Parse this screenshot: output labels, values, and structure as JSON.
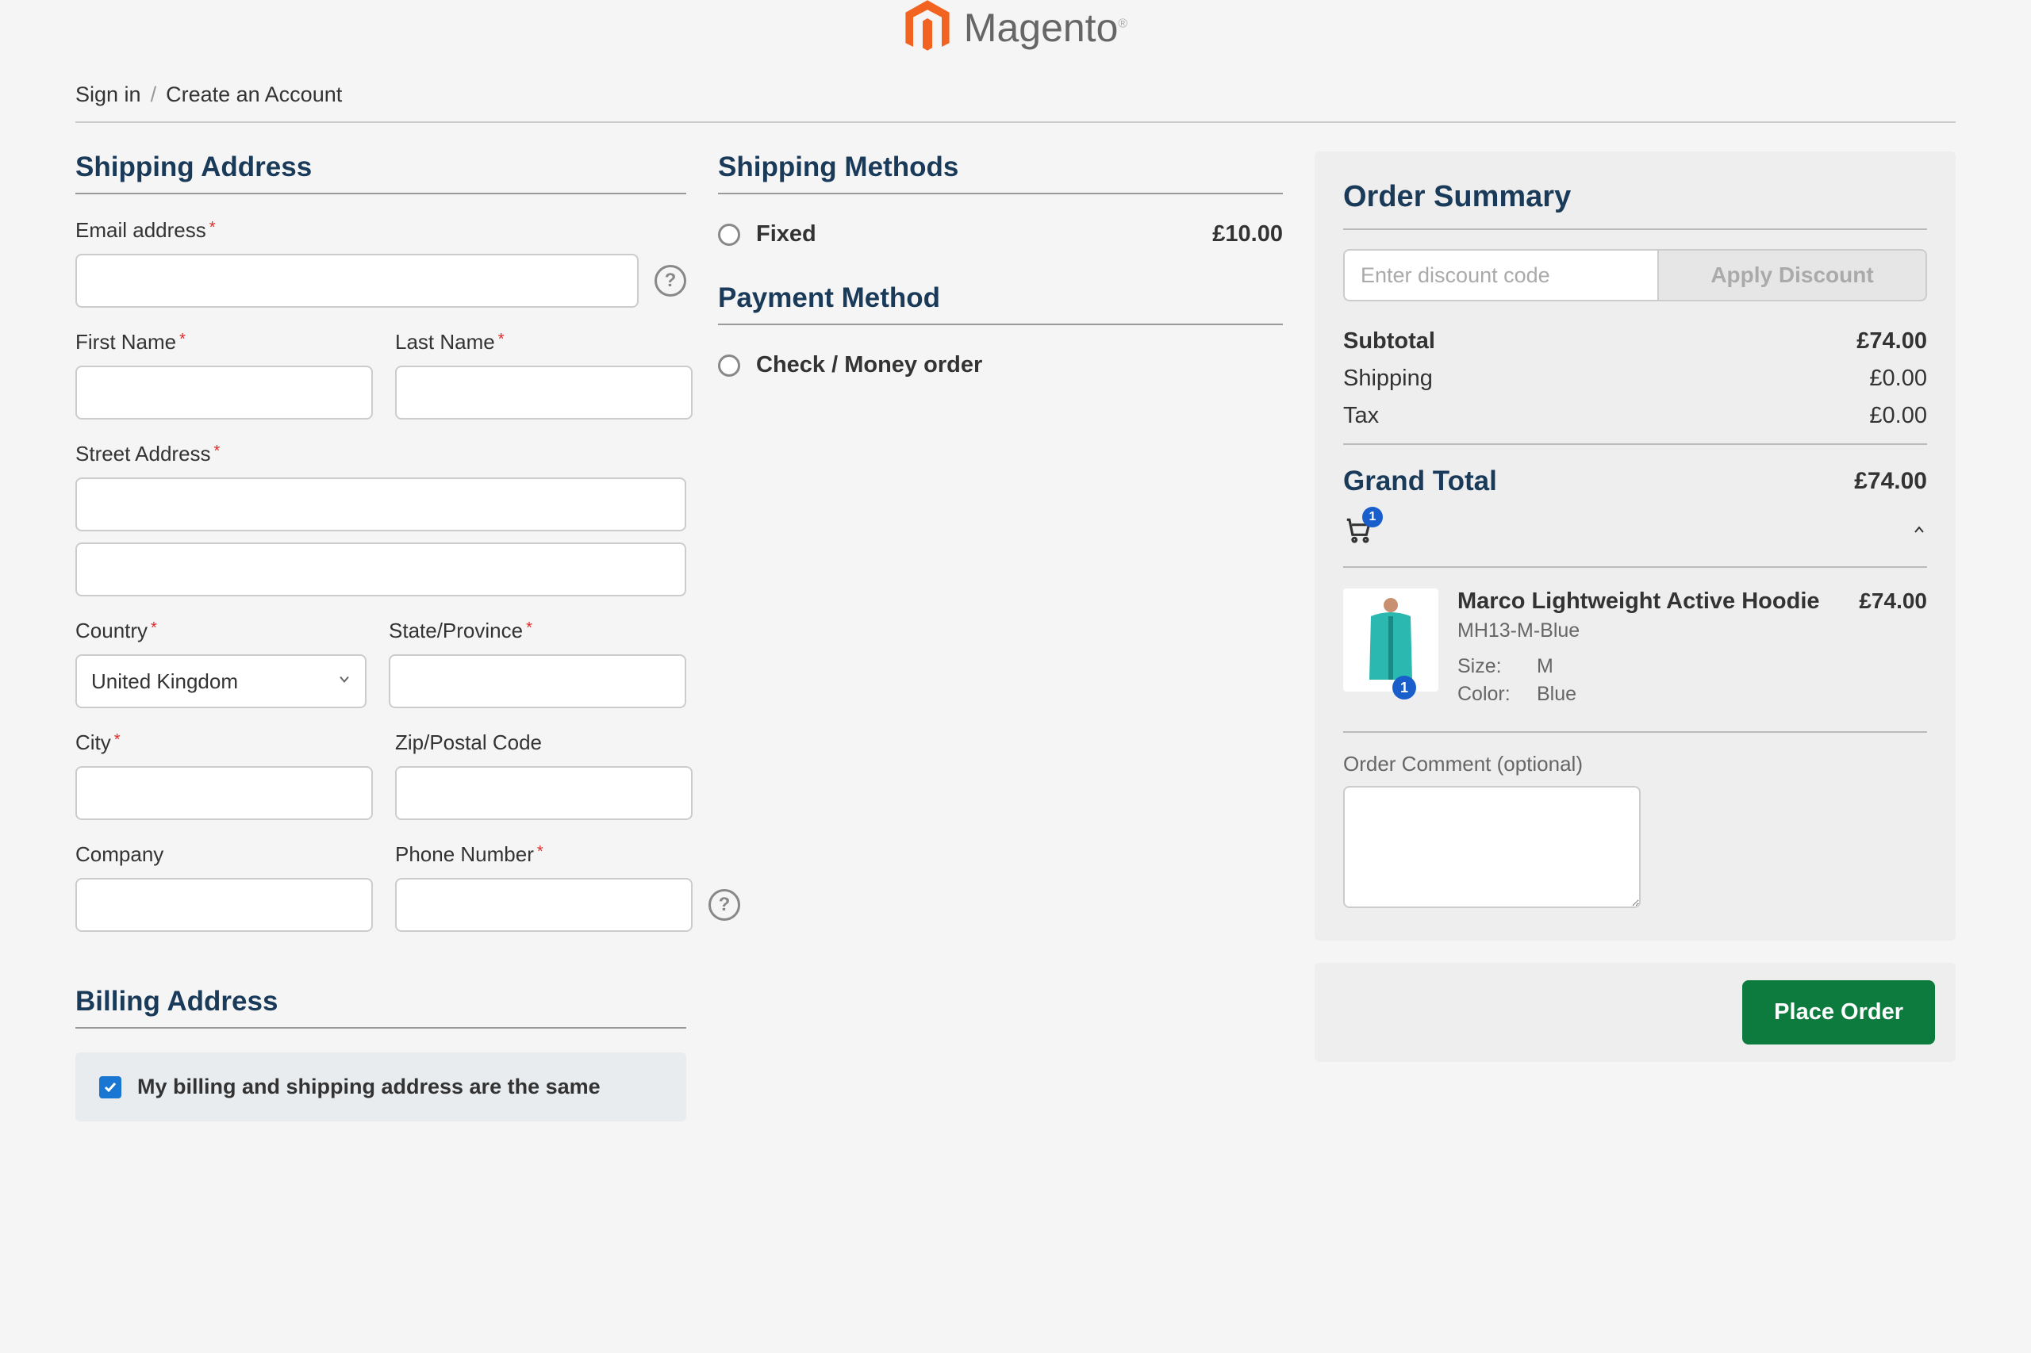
{
  "brand": {
    "name": "Magento"
  },
  "auth": {
    "signin": "Sign in",
    "create": "Create an Account"
  },
  "shipping": {
    "title": "Shipping Address",
    "email_label": "Email address",
    "first_name_label": "First Name",
    "last_name_label": "Last Name",
    "street_label": "Street Address",
    "country_label": "Country",
    "country_value": "United Kingdom",
    "state_label": "State/Province",
    "city_label": "City",
    "zip_label": "Zip/Postal Code",
    "company_label": "Company",
    "phone_label": "Phone Number"
  },
  "billing": {
    "title": "Billing Address",
    "same_label": "My billing and shipping address are the same",
    "same_checked": true
  },
  "methods": {
    "shipping_title": "Shipping Methods",
    "fixed_label": "Fixed",
    "fixed_price": "£10.00",
    "payment_title": "Payment Method",
    "check_label": "Check / Money order"
  },
  "summary": {
    "title": "Order Summary",
    "discount_placeholder": "Enter discount code",
    "apply_label": "Apply Discount",
    "subtotal_label": "Subtotal",
    "subtotal_value": "£74.00",
    "shipping_label": "Shipping",
    "shipping_value": "£0.00",
    "tax_label": "Tax",
    "tax_value": "£0.00",
    "grand_label": "Grand Total",
    "grand_value": "£74.00",
    "cart_count": "1",
    "item": {
      "name": "Marco Lightweight Active Hoodie",
      "sku": "MH13-M-Blue",
      "price": "£74.00",
      "qty": "1",
      "size_label": "Size:",
      "size_value": "M",
      "color_label": "Color:",
      "color_value": "Blue"
    },
    "comment_label": "Order Comment (optional)"
  },
  "actions": {
    "place_order": "Place Order"
  }
}
